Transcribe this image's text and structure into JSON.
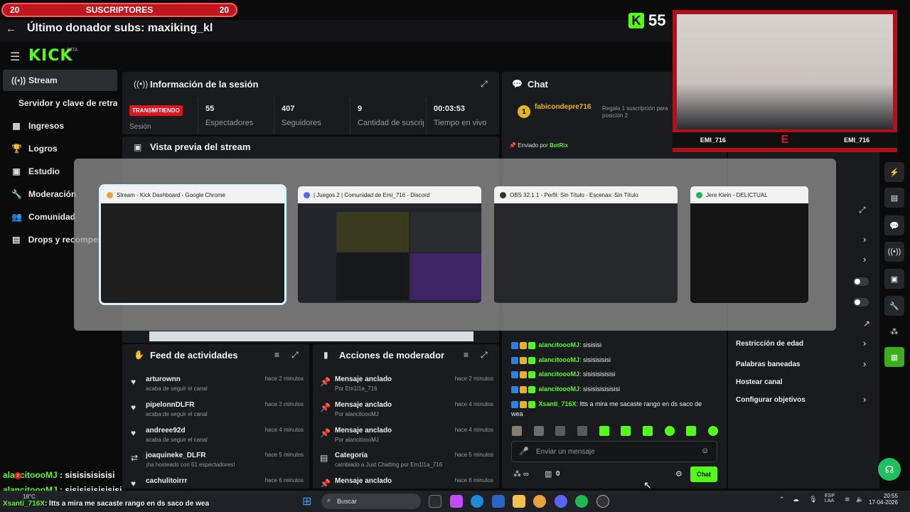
{
  "overlay": {
    "subs_left": "20",
    "subs_label": "SUSCRIPTORES",
    "subs_right": "20",
    "donor_text": "Último donador subs: maxiking_kl",
    "viewer_count": "55",
    "cam_name_left": "EMI_716",
    "cam_name_right": "EMI_716",
    "chat_overlay": [
      {
        "user": "alancitoooMJ",
        "text": "sisisisisisisi"
      },
      {
        "user": "alancitoooMJ",
        "text": "sisisisisisisisi"
      },
      {
        "user": "Xsanti_716X",
        "text": "ltts a mira me sacaste rango en ds saco de wea"
      }
    ]
  },
  "header": {
    "logo": "KICK",
    "beta": "BETA"
  },
  "sidebar": {
    "items": [
      {
        "label": "Stream",
        "icon": "broadcast-icon"
      },
      {
        "label": "Servidor y clave de retransmisión",
        "icon": ""
      },
      {
        "label": "Ingresos",
        "icon": "revenue-icon"
      },
      {
        "label": "Logros",
        "icon": "trophy-icon"
      },
      {
        "label": "Estudio",
        "icon": "studio-icon"
      },
      {
        "label": "Moderación",
        "icon": "wrench-icon"
      },
      {
        "label": "Comunidad",
        "icon": "community-icon"
      },
      {
        "label": "Drops y recompensas",
        "icon": "drops-icon"
      }
    ]
  },
  "session": {
    "title": "Información de la sesión",
    "live_badge": "TRANSMITIENDO",
    "session_label": "Sesión",
    "stats": [
      {
        "value": "55",
        "label": "Espectadores"
      },
      {
        "value": "407",
        "label": "Seguidores"
      },
      {
        "value": "9",
        "label": "Cantidad de suscripciones"
      },
      {
        "value": "00:03:53",
        "label": "Tiempo en vivo"
      }
    ]
  },
  "preview": {
    "title": "Vista previa del stream"
  },
  "switcher": {
    "windows": [
      {
        "title": "Stream - Kick Dashboard - Google Chrome"
      },
      {
        "title": "| Juegos 2 | Comunidad de Emi_716 - Discord"
      },
      {
        "title": "OBS 32.1.1 - Perfil: Sin Título - Escenas: Sin Título"
      },
      {
        "title": "Jere Klein - DELICTUAL"
      }
    ]
  },
  "chat": {
    "title": "Chat",
    "gift": {
      "user": "fabicondepre716",
      "count": "1",
      "text": "Regala 1 suscripción para posición 2"
    },
    "pinned_by_label": "Enviado por",
    "pinned_by": "BotRix",
    "messages": [
      {
        "user": "alancitoooMJ",
        "text": "sisisisi"
      },
      {
        "user": "alancitoooMJ",
        "text": "sisisisisisi"
      },
      {
        "user": "alancitoooMJ",
        "text": "sisisisisisisi"
      },
      {
        "user": "alancitoooMJ",
        "text": "sisisisisisisisi"
      },
      {
        "user": "Xsanti_716X",
        "text": "ltts a mira me sacaste rango en ds saco de"
      },
      {
        "user": "",
        "text": "wea"
      }
    ],
    "input_placeholder": "Enviar un mensaje",
    "points": "0",
    "send_label": "Chat"
  },
  "feed": {
    "title": "Feed de actividades",
    "rows": [
      {
        "name": "arturownn",
        "sub": "acaba de seguir el canal",
        "time": "hace 2 minutos",
        "icon": "heart-icon"
      },
      {
        "name": "pipelonnDLFR",
        "sub": "acaba de seguir el canal",
        "time": "hace 2 minutos",
        "icon": "heart-icon"
      },
      {
        "name": "andreee92d",
        "sub": "acaba de seguir el canal",
        "time": "hace 4 minutos",
        "icon": "heart-icon"
      },
      {
        "name": "joaquineke_DLFR",
        "sub": "¡ha hosteado con 61 espectadores!",
        "time": "hace 5 minutos",
        "icon": "host-icon"
      },
      {
        "name": "cachulitoirrr",
        "sub": "",
        "time": "hace 6 minutos",
        "icon": "heart-icon"
      }
    ]
  },
  "mod": {
    "title": "Acciones de moderador",
    "rows": [
      {
        "name": "Mensaje anclado",
        "sub": "Por Em1l1a_716",
        "time": "hace 2 minutos",
        "icon": "pin-icon"
      },
      {
        "name": "Mensaje anclado",
        "sub": "Por alancitoooMJ",
        "time": "hace 4 minutos",
        "icon": "pin-icon"
      },
      {
        "name": "Mensaje anclado",
        "sub": "Por alancitoooMJ",
        "time": "hace 4 minutos",
        "icon": "pin-icon"
      },
      {
        "name": "Categoría",
        "sub": "cambiado a Just Chatting por Em1l1a_716",
        "time": "hace 5 minutos",
        "icon": "category-icon"
      },
      {
        "name": "Mensaje anclado",
        "sub": "",
        "time": "hace 6 minutos",
        "icon": "pin-icon"
      }
    ]
  },
  "settings": {
    "items": [
      {
        "label": "Restricción de edad"
      },
      {
        "label": "Palabras baneadas"
      },
      {
        "label": "Hostear canal"
      },
      {
        "label": "Configurar objetivos"
      }
    ]
  },
  "taskbar": {
    "search_label": "Buscar",
    "weather_temp": "18°C",
    "weather_desc": "",
    "lang": "ESP",
    "lang_sub": "LAA",
    "time": "20:55",
    "date": "17-04-2026",
    "notif_count": "2"
  }
}
